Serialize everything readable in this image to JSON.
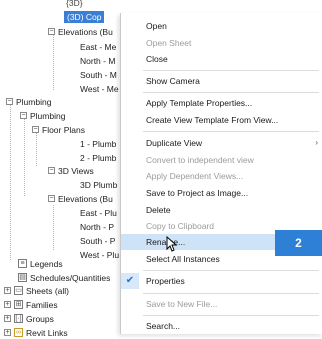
{
  "tree": {
    "top_partial": "{3D}",
    "selected_view": "(3D) Cop",
    "elev_group_1": "Elevations (Bu",
    "elev_1": [
      "East - Me",
      "North - M",
      "South - M",
      "West - Me"
    ],
    "plumbing_top": "Plumbing",
    "plumbing_sub": "Plumbing",
    "floor_plans": "Floor Plans",
    "floor_plan_items": [
      "1 - Plumb",
      "2 - Plumb"
    ],
    "views_3d": "3D Views",
    "views_3d_items": [
      "3D Plumb"
    ],
    "elev_group_2": "Elevations (Bu",
    "elev_2": [
      "East - Plu",
      "North - P",
      "South - P",
      "West - Plu"
    ],
    "legends": "Legends",
    "schedules": "Schedules/Quantities",
    "sheets": "Sheets (all)",
    "families": "Families",
    "groups": "Groups",
    "revit_links": "Revit Links"
  },
  "context_menu": {
    "items": [
      {
        "label": "Open",
        "disabled": false
      },
      {
        "label": "Open Sheet",
        "disabled": true
      },
      {
        "label": "Close",
        "disabled": false
      },
      {
        "label": "Show Camera",
        "disabled": false
      },
      {
        "label": "Apply Template Properties...",
        "disabled": false
      },
      {
        "label": "Create View Template From View...",
        "disabled": false
      },
      {
        "label": "Duplicate View",
        "disabled": false,
        "submenu": true
      },
      {
        "label": "Convert to independent view",
        "disabled": true
      },
      {
        "label": "Apply Dependent Views...",
        "disabled": true
      },
      {
        "label": "Save to Project as Image...",
        "disabled": false
      },
      {
        "label": "Delete",
        "disabled": false
      },
      {
        "label": "Copy to Clipboard",
        "disabled": true
      },
      {
        "label": "Rename...",
        "disabled": false,
        "hovered": true
      },
      {
        "label": "Select All Instances",
        "disabled": false
      },
      {
        "label": "Properties",
        "disabled": false,
        "checked": true
      },
      {
        "label": "Save to New File...",
        "disabled": true
      },
      {
        "label": "Search...",
        "disabled": false
      }
    ],
    "submenu_arrow": "›",
    "check_mark": "✔"
  },
  "step_badge": "2",
  "colors": {
    "selection": "#3a7fd5",
    "hover": "#cfe3f8",
    "badge": "#2e7fd6",
    "disabled_text": "#9b9b9b"
  }
}
